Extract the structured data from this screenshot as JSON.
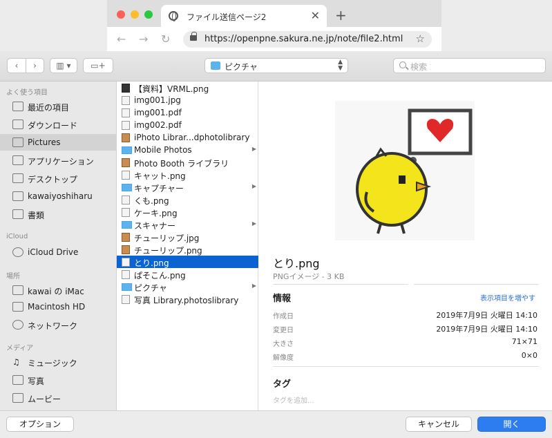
{
  "browser": {
    "tab_title": "ファイル送信ページ2",
    "url": "https://openpne.sakura.ne.jp/note/file2.html",
    "colors": {
      "close": "#fe5f57",
      "minimize": "#febc2e",
      "zoom": "#28c840"
    }
  },
  "toolbar": {
    "location": "ピクチャ",
    "search_placeholder": "検索"
  },
  "sidebar": {
    "favorites_header": "よく使う項目",
    "favorites": [
      {
        "label": "最近の項目",
        "icon": "recents-icon"
      },
      {
        "label": "ダウンロード",
        "icon": "folder-icon"
      },
      {
        "label": "Pictures",
        "icon": "folder-icon",
        "selected": true
      },
      {
        "label": "アプリケーション",
        "icon": "applications-icon"
      },
      {
        "label": "デスクトップ",
        "icon": "desktop-icon"
      },
      {
        "label": "kawaiyoshiharu",
        "icon": "home-icon"
      },
      {
        "label": "書類",
        "icon": "folder-icon"
      }
    ],
    "icloud_header": "iCloud",
    "icloud": [
      {
        "label": "iCloud Drive",
        "icon": "cloud-icon"
      }
    ],
    "locations_header": "場所",
    "locations": [
      {
        "label": "kawai の iMac",
        "icon": "imac-icon"
      },
      {
        "label": "Macintosh HD",
        "icon": "disk-icon"
      },
      {
        "label": "ネットワーク",
        "icon": "network-icon"
      }
    ],
    "media_header": "メディア",
    "media": [
      {
        "label": "ミュージック",
        "icon": "music-icon"
      },
      {
        "label": "写真",
        "icon": "camera-icon"
      },
      {
        "label": "ムービー",
        "icon": "film-icon"
      }
    ]
  },
  "files": [
    {
      "name": "【資料】VRML.png",
      "kind": "dark"
    },
    {
      "name": "img001.jpg",
      "kind": "doc"
    },
    {
      "name": "img001.pdf",
      "kind": "doc"
    },
    {
      "name": "img002.pdf",
      "kind": "doc"
    },
    {
      "name": "iPhoto Librar...dphotolibrary",
      "kind": "img"
    },
    {
      "name": "Mobile Photos",
      "kind": "folder",
      "has_children": true
    },
    {
      "name": "Photo Booth ライブラリ",
      "kind": "img"
    },
    {
      "name": "キャット.png",
      "kind": "doc"
    },
    {
      "name": "キャプチャー",
      "kind": "folder",
      "has_children": true
    },
    {
      "name": "くも.png",
      "kind": "doc"
    },
    {
      "name": "ケーキ.png",
      "kind": "doc"
    },
    {
      "name": "スキャナー",
      "kind": "folder",
      "has_children": true
    },
    {
      "name": "チューリップ.jpg",
      "kind": "img"
    },
    {
      "name": "チューリップ.png",
      "kind": "img"
    },
    {
      "name": "とり.png",
      "kind": "doc",
      "selected": true
    },
    {
      "name": "ぱそこん.png",
      "kind": "doc"
    },
    {
      "name": "ピクチャ",
      "kind": "folder",
      "has_children": true
    },
    {
      "name": "写真 Library.photoslibrary",
      "kind": "doc"
    }
  ],
  "preview": {
    "filename": "とり.png",
    "kind": "PNGイメージ - 3 KB",
    "info_header": "情報",
    "show_more": "表示項目を増やす",
    "rows": [
      {
        "key": "作成日",
        "value": "2019年7月9日 火曜日 14:10"
      },
      {
        "key": "変更日",
        "value": "2019年7月9日 火曜日 14:10"
      },
      {
        "key": "大きさ",
        "value": "71×71"
      },
      {
        "key": "解像度",
        "value": "0×0"
      }
    ],
    "tags_header": "タグ",
    "tags_placeholder": "タグを追加..."
  },
  "buttons": {
    "options": "オプション",
    "cancel": "キャンセル",
    "open": "開く"
  }
}
